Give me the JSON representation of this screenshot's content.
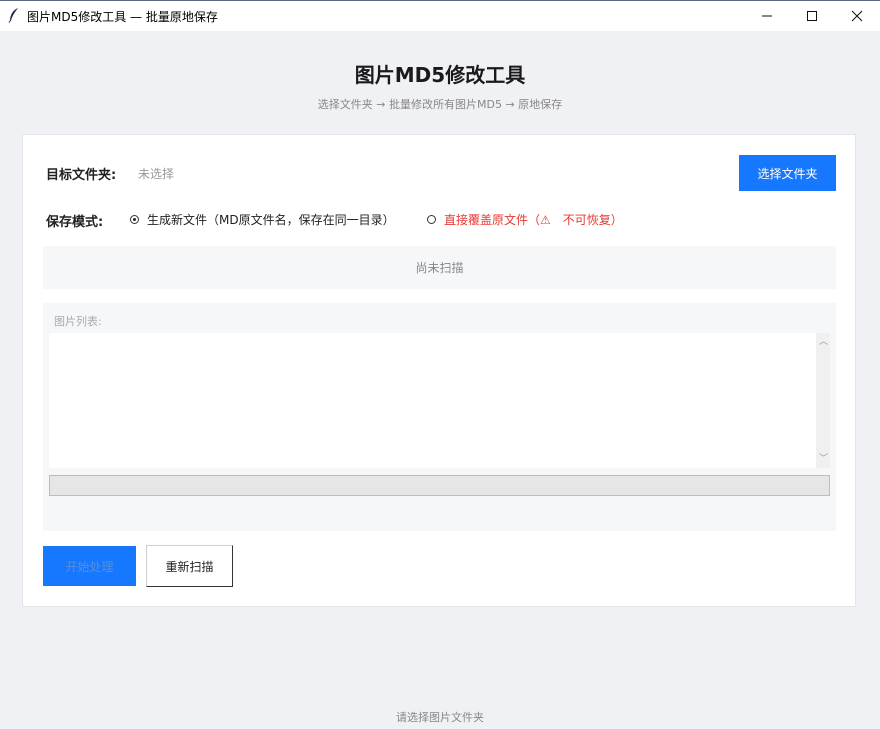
{
  "window": {
    "title": "图片MD5修改工具 — 批量原地保存",
    "icon": "feather-icon"
  },
  "header": {
    "title": "图片MD5修改工具",
    "subtitle": "选择文件夹 → 批量修改所有图片MD5 → 原地保存"
  },
  "folder": {
    "label": "目标文件夹:",
    "value": "未选择",
    "button_label": "选择文件夹"
  },
  "save_mode": {
    "label": "保存模式:",
    "options": [
      {
        "label": "生成新文件（MD原文件名，保存在同一目录）",
        "selected": true
      },
      {
        "label": "直接覆盖原文件（⚠　不可恢复）",
        "selected": false,
        "color": "#e53935"
      }
    ]
  },
  "scan_status": "尚未扫描",
  "image_list": {
    "label": "图片列表:",
    "items": [],
    "progress": 0
  },
  "actions": {
    "start_label": "开始处理",
    "rescan_label": "重新扫描"
  },
  "status_bar": "请选择图片文件夹",
  "colors": {
    "accent": "#1677ff",
    "danger": "#e53935",
    "background": "#f0f1f5"
  }
}
